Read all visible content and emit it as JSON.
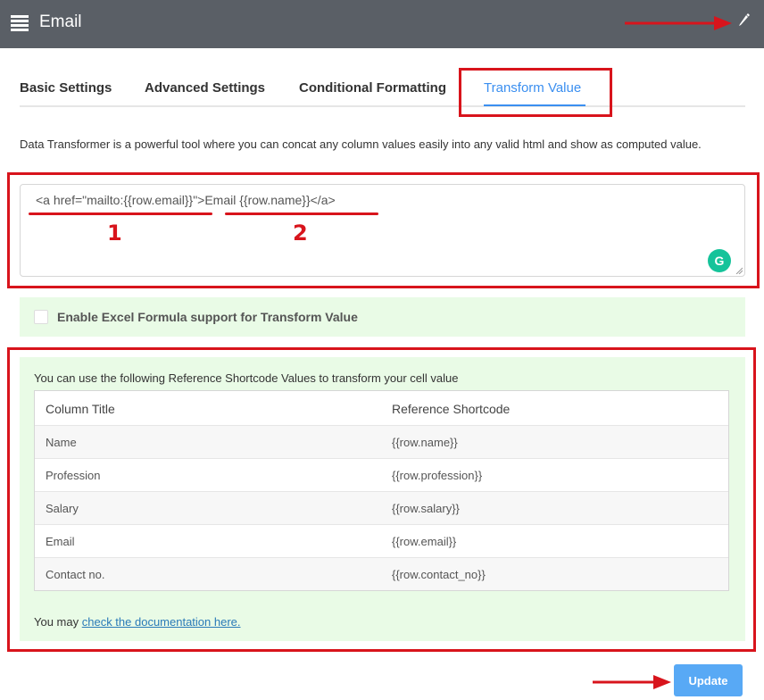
{
  "header": {
    "title": "Email",
    "menu_icon": "menu-icon",
    "edit_icon": "pencil-icon"
  },
  "tabs": [
    {
      "label": "Basic Settings",
      "active": false
    },
    {
      "label": "Advanced Settings",
      "active": false
    },
    {
      "label": "Conditional Formatting",
      "active": false
    },
    {
      "label": "Transform Value",
      "active": true
    }
  ],
  "description": "Data Transformer is a powerful tool where you can concat any column values easily into any valid html and show as computed value.",
  "editor": {
    "value": "<a href=\"mailto:{{row.email}}\">Email {{row.name}}</a>"
  },
  "excel": {
    "label": "Enable Excel Formula support for Transform Value",
    "checked": false
  },
  "shortcodes": {
    "intro": "You can use the following Reference Shortcode Values to transform your cell value",
    "columns": [
      "Column Title",
      "Reference Shortcode"
    ],
    "rows": [
      [
        "Name",
        "{{row.name}}"
      ],
      [
        "Profession",
        "{{row.profession}}"
      ],
      [
        "Salary",
        "{{row.salary}}"
      ],
      [
        "Email",
        "{{row.email}}"
      ],
      [
        "Contact no.",
        "{{row.contact_no}}"
      ]
    ],
    "footer_prefix": "You may",
    "footer_link": "check the documentation here."
  },
  "update_button": "Update",
  "annotations": {
    "labels": [
      "1",
      "2"
    ],
    "color": "#d8141c"
  },
  "colors": {
    "header_bg": "#5a5f66",
    "accent": "#3b8ff0",
    "panel_bg": "#e9fbe6",
    "button_bg": "#58a9f5"
  }
}
